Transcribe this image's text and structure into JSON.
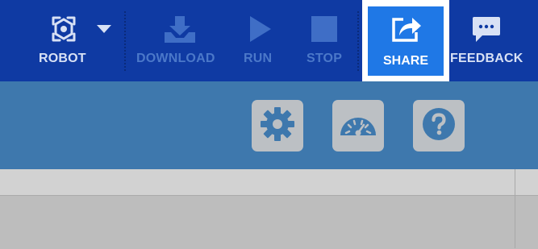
{
  "toolbar": {
    "robot_label": "ROBOT",
    "download_label": "DOWNLOAD",
    "run_label": "RUN",
    "stop_label": "STOP",
    "share_label": "SHARE",
    "feedback_label": "FEEDBACK"
  },
  "icons": {
    "robot": "robot-icon",
    "robot_menu": "caret-down-icon",
    "download": "download-icon",
    "run": "play-icon",
    "stop": "stop-icon",
    "share": "share-icon",
    "feedback": "speech-bubble-icon",
    "settings": "gear-icon",
    "gauge": "gauge-icon",
    "help": "question-mark-icon"
  },
  "colors": {
    "topbar": "#0f3aa3",
    "share_active": "#1f78e6",
    "subbar": "#3e78ad",
    "disabled_text": "#4b78c9",
    "tool_button": "#bcc0c4"
  }
}
